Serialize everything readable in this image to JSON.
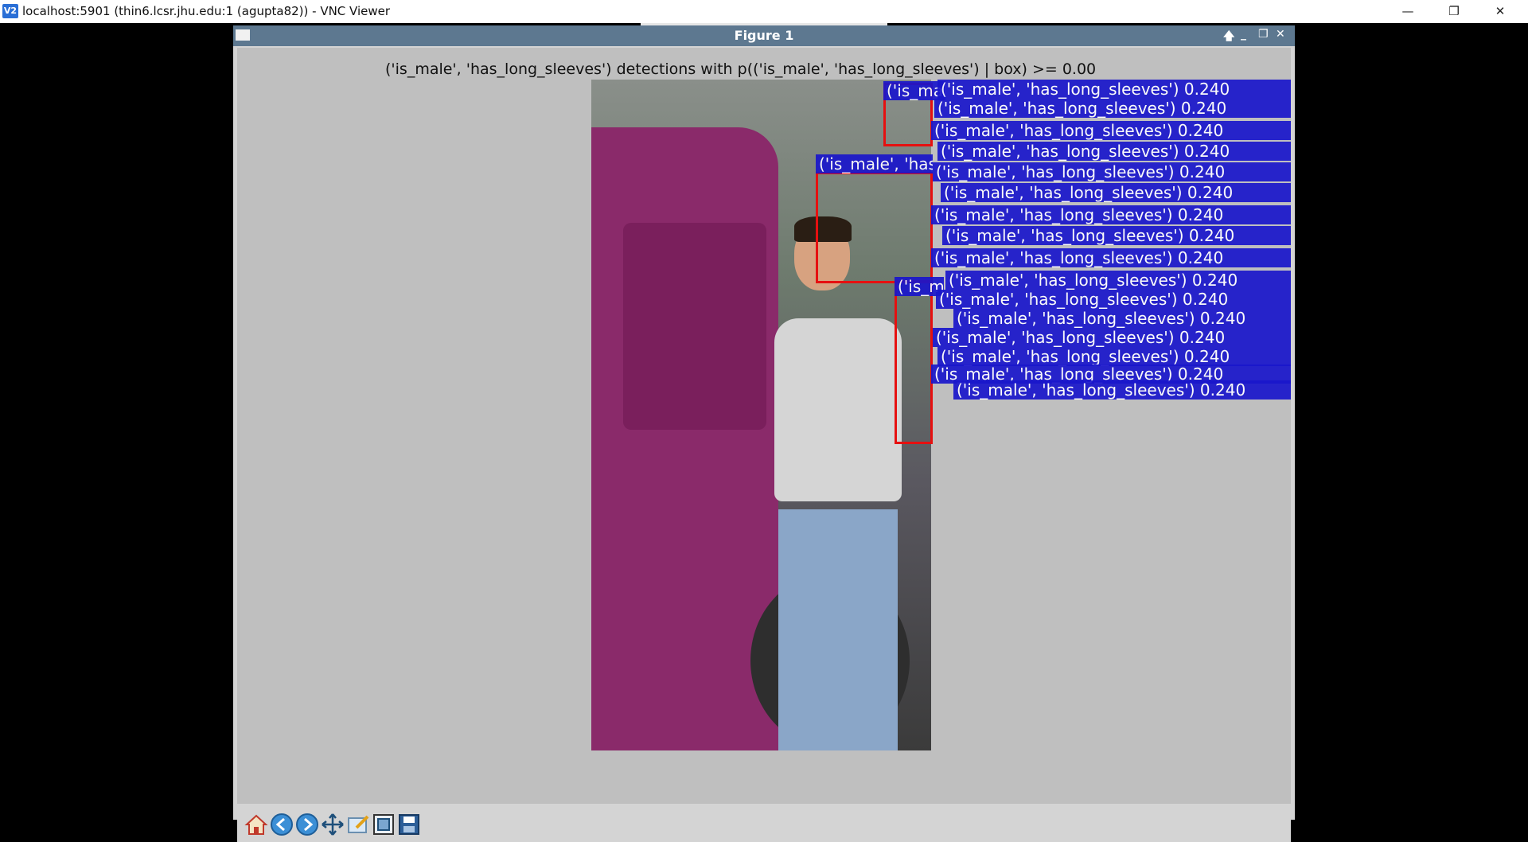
{
  "window": {
    "icon_text": "V2",
    "title": "localhost:5901 (thin6.lcsr.jhu.edu:1 (agupta82)) - VNC Viewer",
    "min_glyph": "—",
    "max_glyph": "❐",
    "close_glyph": "✕"
  },
  "figure": {
    "title": "Figure 1",
    "up_glyph": "🡅",
    "min_glyph": "_",
    "restore_glyph": "❐",
    "close_glyph": "✕"
  },
  "plot": {
    "title": "('is_male', 'has_long_sleeves') detections with p(('is_male', 'has_long_sleeves') | box) >= 0.00"
  },
  "detections": {
    "label_short1": "('is_male', 'has_long_sleeves') 0.240",
    "label_short2": "('is_male', 'has",
    "label_short3": "('is_male', 'has_long_sleeves') 0.240",
    "labels": [
      "('is_male', 'has_long_sleeves') 0.240",
      "('is_male', 'has_long_sleeves') 0.240",
      "('is_male', 'has_long_sleeves') 0.240",
      "('is_male', 'has_long_sleeves') 0.240",
      "('is_male', 'has_long_sleeves') 0.240",
      "('is_male', 'has_long_sleeves') 0.240",
      "('is_male', 'has_long_sleeves') 0.240",
      "('is_male', 'has_long_sleeves') 0.240",
      "('is_male', 'has_long_sleeves') 0.240",
      "('is_male', 'has_long_sleeves') 0.240",
      "('is_male', 'has_long_sleeves') 0.240",
      "('is_male', 'has_long_sleeves') 0.240",
      "('is_male', 'has_long_sleeves') 0.240",
      "('is_male', 'has_long_sleeves') 0.240",
      "('is_male', 'has_long_sleeves') 0.240",
      "('is_male', 'has_long_sleeves') 0.240"
    ]
  },
  "toolbar": {
    "buttons": [
      "home",
      "back",
      "forward",
      "pan",
      "configure-subplots",
      "zoom-to-rect",
      "save"
    ]
  },
  "colors": {
    "box": "#e61010",
    "label_bg": "#1a16cc",
    "figure_title_bg": "#5d7890"
  }
}
